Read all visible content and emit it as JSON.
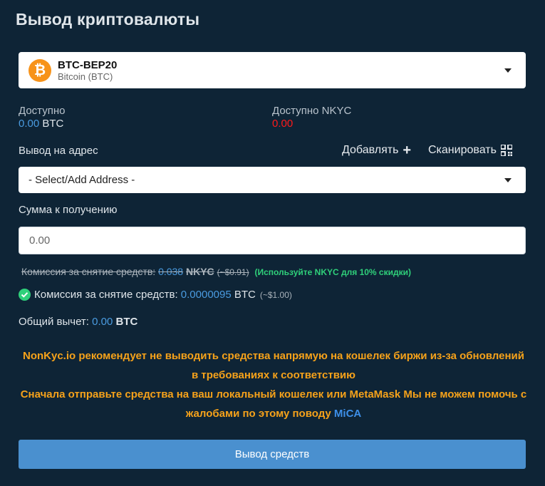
{
  "title": "Вывод криптовалюты",
  "coin": {
    "symbol_glyph": "₿",
    "name": "BTC-BEP20",
    "subtitle": "Bitcoin (BTC)",
    "icon": "bitcoin-icon",
    "icon_color": "#f7931a"
  },
  "available": {
    "label": "Доступно",
    "value": "0.00",
    "unit": "BTC"
  },
  "available_nkyc": {
    "label": "Доступно NKYC",
    "value": "0.00"
  },
  "address": {
    "label": "Вывод на адрес",
    "add_label": "Добавлять",
    "scan_label": "Сканировать",
    "select_value": "- Select/Add Address -"
  },
  "amount": {
    "label": "Сумма к получению",
    "placeholder": "0.00"
  },
  "fee_nkyc": {
    "label": "Комиссия за снятие средств:",
    "value": "0.038",
    "unit": "NKYC",
    "usd": "(~$0.91)",
    "note": "(Используйте NKYC для 10% скидки)"
  },
  "fee": {
    "label": "Комиссия за снятие средств:",
    "value": "0.0000095",
    "unit": "BTC",
    "usd": "(~$1.00)"
  },
  "total": {
    "label": "Общий вычет:",
    "value": "0.00",
    "unit": "BTC"
  },
  "warning": {
    "line1": "NonKyc.io рекомендует не выводить средства напрямую на кошелек биржи из-за обновлений в требованиях к соответствию",
    "line2": "Сначала отправьте средства на ваш локальный кошелек или MetaMask Мы не можем помочь с жалобами по этому поводу",
    "link": "MiCA"
  },
  "submit_label": "Вывод средств",
  "colors": {
    "background": "#0e2436",
    "accent_blue": "#4a9be0",
    "warning_orange": "#f6a21a",
    "success_green": "#2fd07a",
    "error_red": "#ff1a1a",
    "button": "#4a90cf"
  }
}
